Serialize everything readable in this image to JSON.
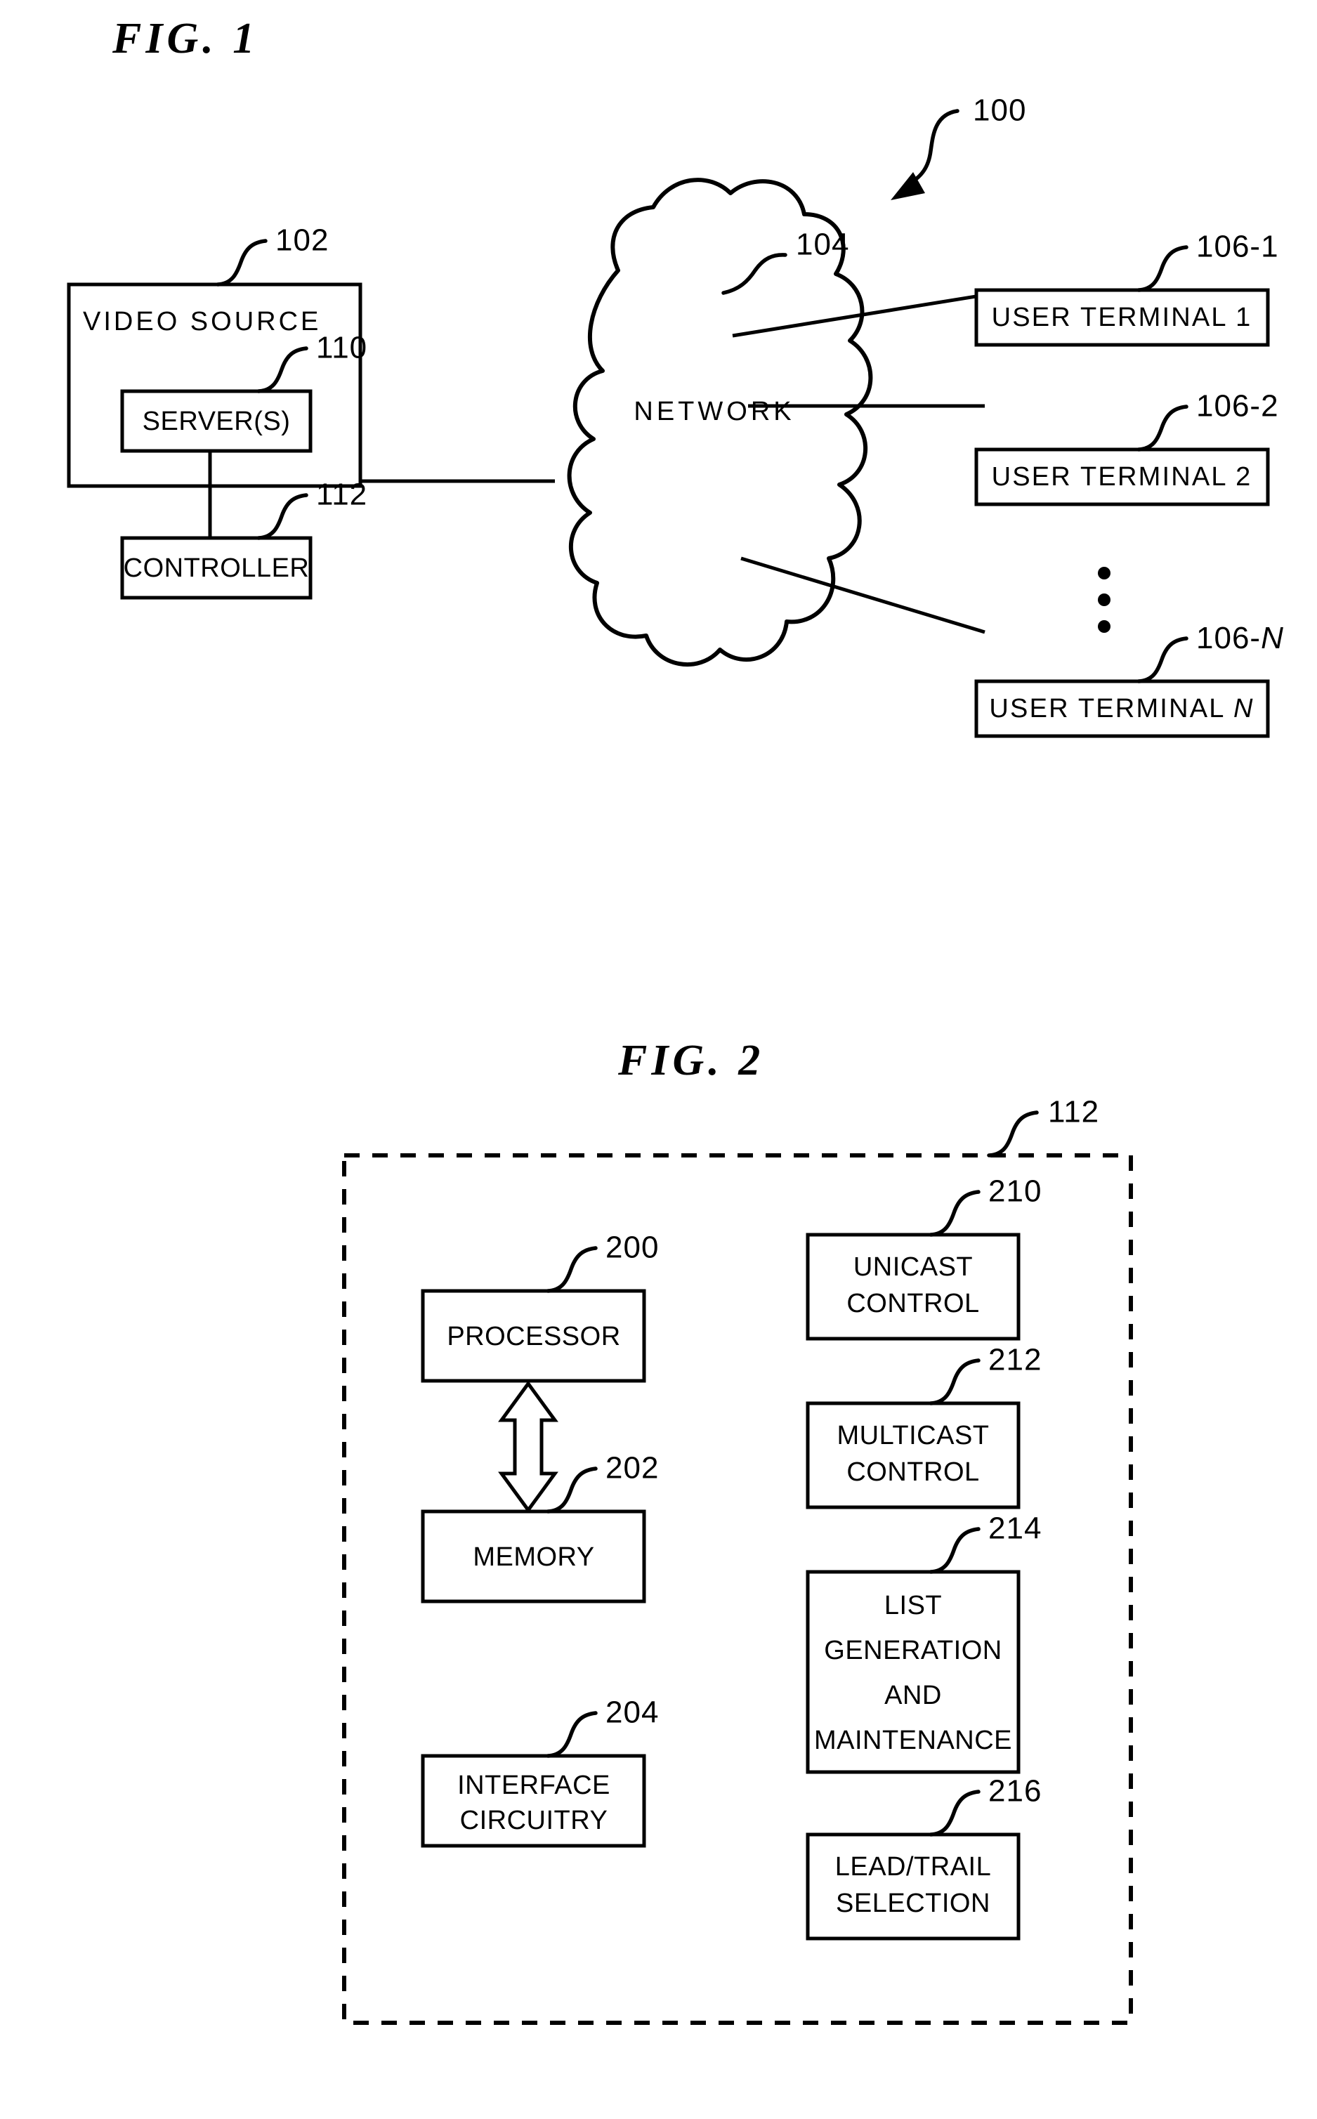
{
  "document": {
    "type": "patent-drawing-sheet",
    "background": "#ffffff",
    "ink": "#000000"
  },
  "figure1": {
    "caption": "FIG.  1",
    "system_ref": "100",
    "video_source": {
      "label": "VIDEO SOURCE",
      "ref": "102",
      "children": [
        {
          "label": "SERVER(S)",
          "ref": "110"
        },
        {
          "label": "CONTROLLER",
          "ref": "112"
        }
      ]
    },
    "network": {
      "label": "NETWORK",
      "ref": "104"
    },
    "terminals": [
      {
        "label": "USER TERMINAL 1",
        "ref": "106-1",
        "italic_suffix": ""
      },
      {
        "label": "USER TERMINAL 2",
        "ref": "106-2",
        "italic_suffix": ""
      },
      {
        "label": "USER TERMINAL ",
        "ref": "106-",
        "italic_suffix": "N"
      }
    ],
    "ellipsis": "• • •"
  },
  "figure2": {
    "caption": "FIG.  2",
    "container_ref": "112",
    "left_column": [
      {
        "label": "PROCESSOR",
        "ref": "200"
      },
      {
        "label": "MEMORY",
        "ref": "202"
      },
      {
        "label_lines": [
          "INTERFACE",
          "CIRCUITRY"
        ],
        "ref": "204"
      }
    ],
    "right_column": [
      {
        "label_lines": [
          "UNICAST",
          "CONTROL"
        ],
        "ref": "210"
      },
      {
        "label_lines": [
          "MULTICAST",
          "CONTROL"
        ],
        "ref": "212"
      },
      {
        "label_lines": [
          "LIST",
          "GENERATION",
          "AND",
          "MAINTENANCE"
        ],
        "ref": "214"
      },
      {
        "label_lines": [
          "LEAD/TRAIL",
          "SELECTION"
        ],
        "ref": "216"
      }
    ]
  }
}
